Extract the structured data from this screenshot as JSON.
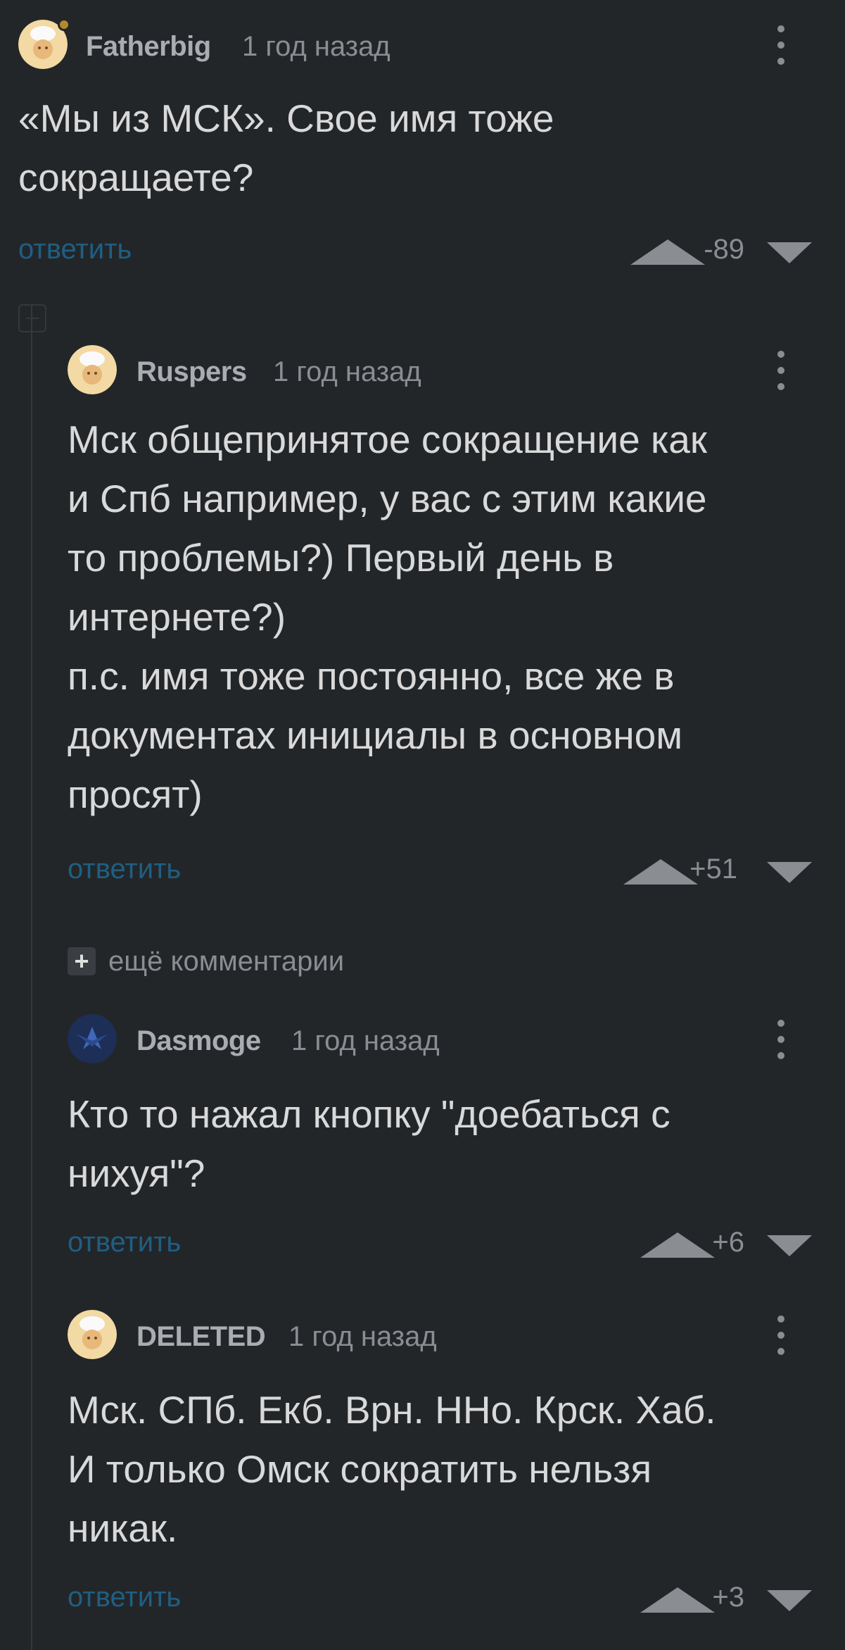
{
  "comments": [
    {
      "username": "Fatherbig",
      "time": "1 год назад",
      "text": "«Мы из МСК». Свое имя тоже\nсокращаете?",
      "reply_label": "ответить",
      "rating": "-89",
      "avatar": "chef-avatar-icon",
      "online": true
    },
    {
      "username": "Ruspers",
      "time": "1 год назад",
      "text": "Мск общепринятое сокращение как\nи Спб например, у вас с этим какие\nто проблемы?) Первый день в\nинтернете?)\nп.с. имя тоже постоянно, все же в\nдокументах инициалы в основном\nпросят)",
      "reply_label": "ответить",
      "rating": "+51",
      "avatar": "chef-avatar-icon"
    },
    {
      "username": "Dasmoge",
      "time": "1 год назад",
      "text": "Кто то нажал кнопку \"доебаться с\nнихуя\"?",
      "reply_label": "ответить",
      "rating": "+6",
      "avatar": "bird-avatar-icon"
    },
    {
      "username": "DELETED",
      "time": "1 год назад",
      "text": "Мск. СПб. Екб. Врн. ННо. Крск. Хаб.\nИ только Омск сократить нельзя\nникак.",
      "reply_label": "ответить",
      "rating": "+3",
      "avatar": "chef-avatar-icon"
    }
  ],
  "more_comments": {
    "icon": "+",
    "label": "ещё комментарии"
  },
  "colors": {
    "background": "#232629",
    "text": "#d9d9d9",
    "muted": "#8a8e92",
    "link": "#1f5f82",
    "online": "#b38a2b"
  }
}
